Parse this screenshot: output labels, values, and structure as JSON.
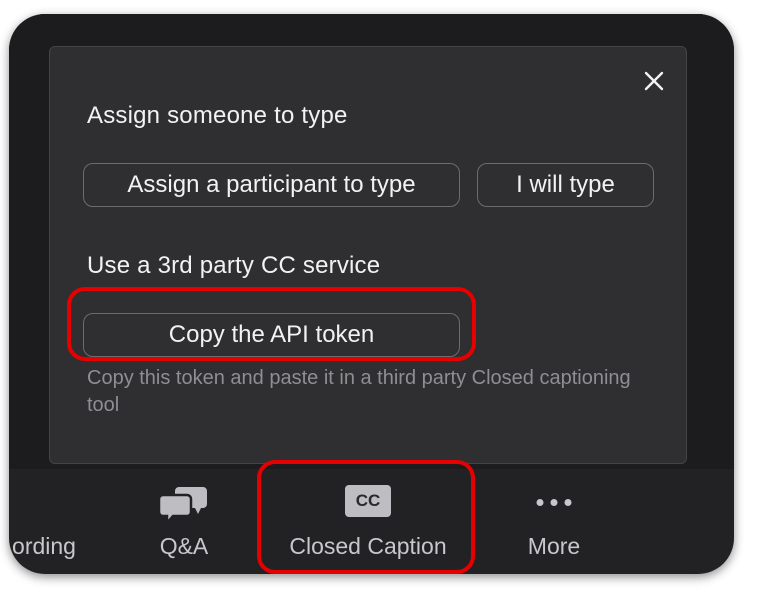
{
  "dialog": {
    "close_label": "×",
    "assign_section": {
      "title": "Assign someone to type",
      "assign_participant_label": "Assign a participant to type",
      "self_type_label": "I will type"
    },
    "third_party_section": {
      "title": "Use a 3rd party CC service",
      "copy_token_label": "Copy the API token",
      "hint": "Copy this token and paste it in a third party Closed captioning tool"
    }
  },
  "toolbar": {
    "items": [
      {
        "label": "ording",
        "icon": "recording-icon"
      },
      {
        "label": "Q&A",
        "icon": "qa-chat-bubbles-icon"
      },
      {
        "label": "Closed Caption",
        "icon": "closed-caption-icon",
        "icon_text": "CC"
      },
      {
        "label": "More",
        "icon": "more-dots-icon"
      }
    ]
  },
  "colors": {
    "highlight": "#e60000",
    "panel_bg": "#2f2f31",
    "toolbar_bg": "#222224"
  }
}
